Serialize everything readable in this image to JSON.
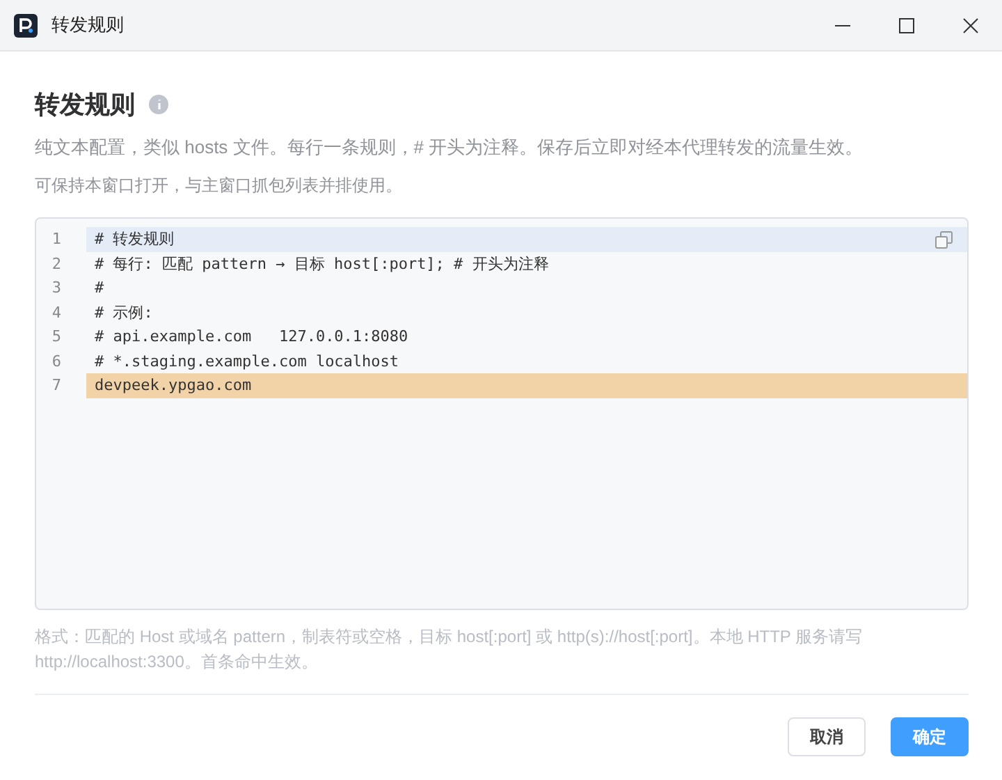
{
  "window": {
    "title": "转发规则"
  },
  "heading": "转发规则",
  "description": "纯文本配置，类似 hosts 文件。每行一条规则，# 开头为注释。保存后立即对经本代理转发的流量生效。",
  "note": "可保持本窗口打开，与主窗口抓包列表并排使用。",
  "editor": {
    "lines": [
      {
        "number": "1",
        "text": "# 转发规则",
        "current": true,
        "selected": false
      },
      {
        "number": "2",
        "text": "# 每行: 匹配 pattern → 目标 host[:port]; # 开头为注释",
        "current": false,
        "selected": false
      },
      {
        "number": "3",
        "text": "#",
        "current": false,
        "selected": false
      },
      {
        "number": "4",
        "text": "# 示例:",
        "current": false,
        "selected": false
      },
      {
        "number": "5",
        "text": "# api.example.com   127.0.0.1:8080",
        "current": false,
        "selected": false
      },
      {
        "number": "6",
        "text": "# *.staging.example.com localhost",
        "current": false,
        "selected": false
      },
      {
        "number": "7",
        "text": "devpeek.ypgao.com",
        "current": false,
        "selected": true
      }
    ]
  },
  "hint": "格式：匹配的 Host 或域名 pattern，制表符或空格，目标 host[:port] 或 http(s)://host[:port]。本地 HTTP 服务请写 http://localhost:3300。首条命中生效。",
  "buttons": [
    {
      "label": "取消",
      "kind": "secondary"
    },
    {
      "label": "确定",
      "kind": "primary"
    }
  ]
}
